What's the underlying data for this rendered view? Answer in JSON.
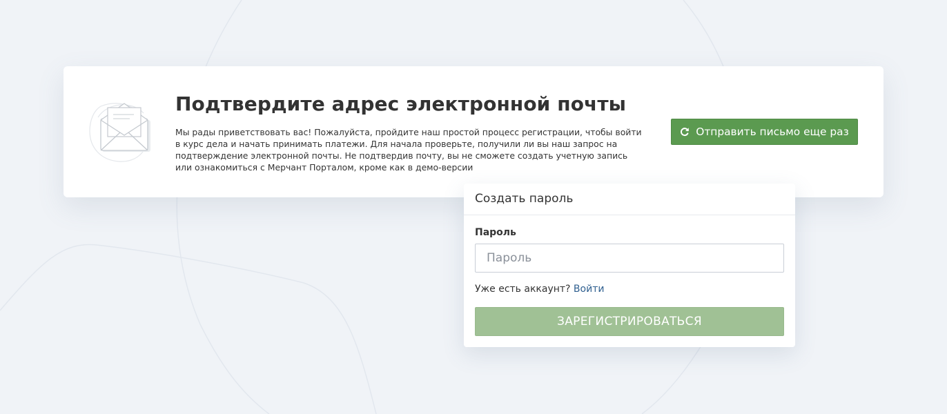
{
  "verify_card": {
    "title": "Подтвердите адрес электронной почты",
    "text": "Мы рады приветствовать вас! Пожалуйста, пройдите наш простой процесс регистрации, чтобы войти в курс дела и начать принимать платежи. Для начала проверьте, получили ли вы наш запрос на подтверждение электронной почты. Не подтвердив почту, вы не сможете создать учетную запись или ознакомиться с Мерчант Порталом, кроме как в демо-версии",
    "resend_label": "Отправить письмо еще раз",
    "resend_icon": "refresh-icon",
    "illustration_icon": "envelope-icon"
  },
  "password_card": {
    "title": "Создать пароль",
    "password_label": "Пароль",
    "password_placeholder": "Пароль",
    "password_value": "",
    "have_account_text": "Уже есть аккаунт?",
    "login_link": "Войти",
    "register_label": "ЗАРЕГИСТРИРОВАТЬСЯ"
  },
  "colors": {
    "background": "#f0f3f7",
    "primary_green": "#5b9a50",
    "disabled_green": "#a0c195",
    "link_blue": "#2f5f8f"
  }
}
